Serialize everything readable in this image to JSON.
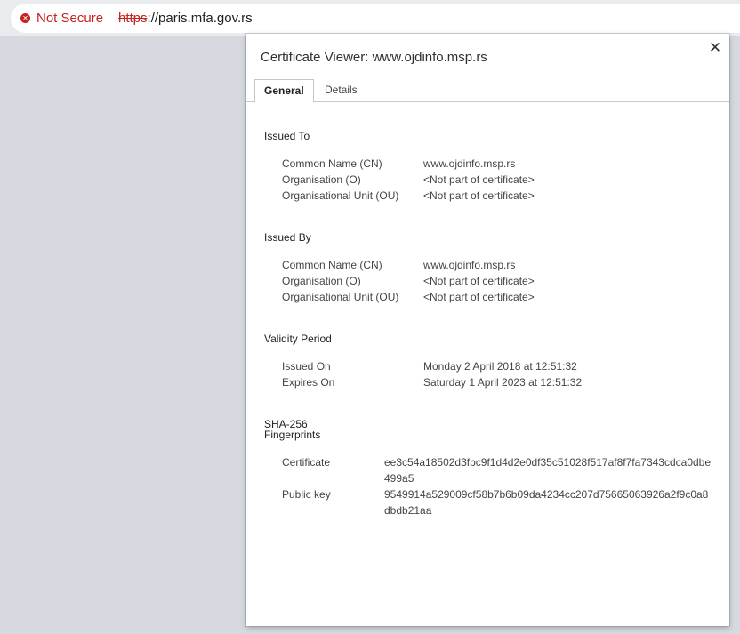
{
  "browser": {
    "security_label": "Not Secure",
    "url_scheme": "https",
    "url_rest": "://paris.mfa.gov.rs",
    "security_icon": "x-circle-icon"
  },
  "dialog": {
    "title": "Certificate Viewer: www.ojdinfo.msp.rs",
    "close_icon": "close-icon",
    "tabs": [
      {
        "label": "General",
        "active": true
      },
      {
        "label": "Details",
        "active": false
      }
    ],
    "issued_to": {
      "title": "Issued To",
      "rows": [
        {
          "label": "Common Name (CN)",
          "value": "www.ojdinfo.msp.rs"
        },
        {
          "label": "Organisation (O)",
          "value": "<Not part of certificate>"
        },
        {
          "label": "Organisational Unit (OU)",
          "value": "<Not part of certificate>"
        }
      ]
    },
    "issued_by": {
      "title": "Issued By",
      "rows": [
        {
          "label": "Common Name (CN)",
          "value": "www.ojdinfo.msp.rs"
        },
        {
          "label": "Organisation (O)",
          "value": "<Not part of certificate>"
        },
        {
          "label": "Organisational Unit (OU)",
          "value": "<Not part of certificate>"
        }
      ]
    },
    "validity": {
      "title": "Validity Period",
      "rows": [
        {
          "label": "Issued On",
          "value": "Monday 2 April 2018 at 12:51:32"
        },
        {
          "label": "Expires On",
          "value": "Saturday 1 April 2023 at 12:51:32"
        }
      ]
    },
    "fingerprints": {
      "title_line1": "SHA-256",
      "title_line2": "Fingerprints",
      "rows": [
        {
          "label": "Certificate",
          "value": "ee3c54a18502d3fbc9f1d4d2e0df35c51028f517af8f7fa7343cdca0dbe499a5"
        },
        {
          "label": "Public key",
          "value": "9549914a529009cf58b7b6b09da4234cc207d75665063926a2f9c0a8dbdb21aa"
        }
      ]
    }
  }
}
